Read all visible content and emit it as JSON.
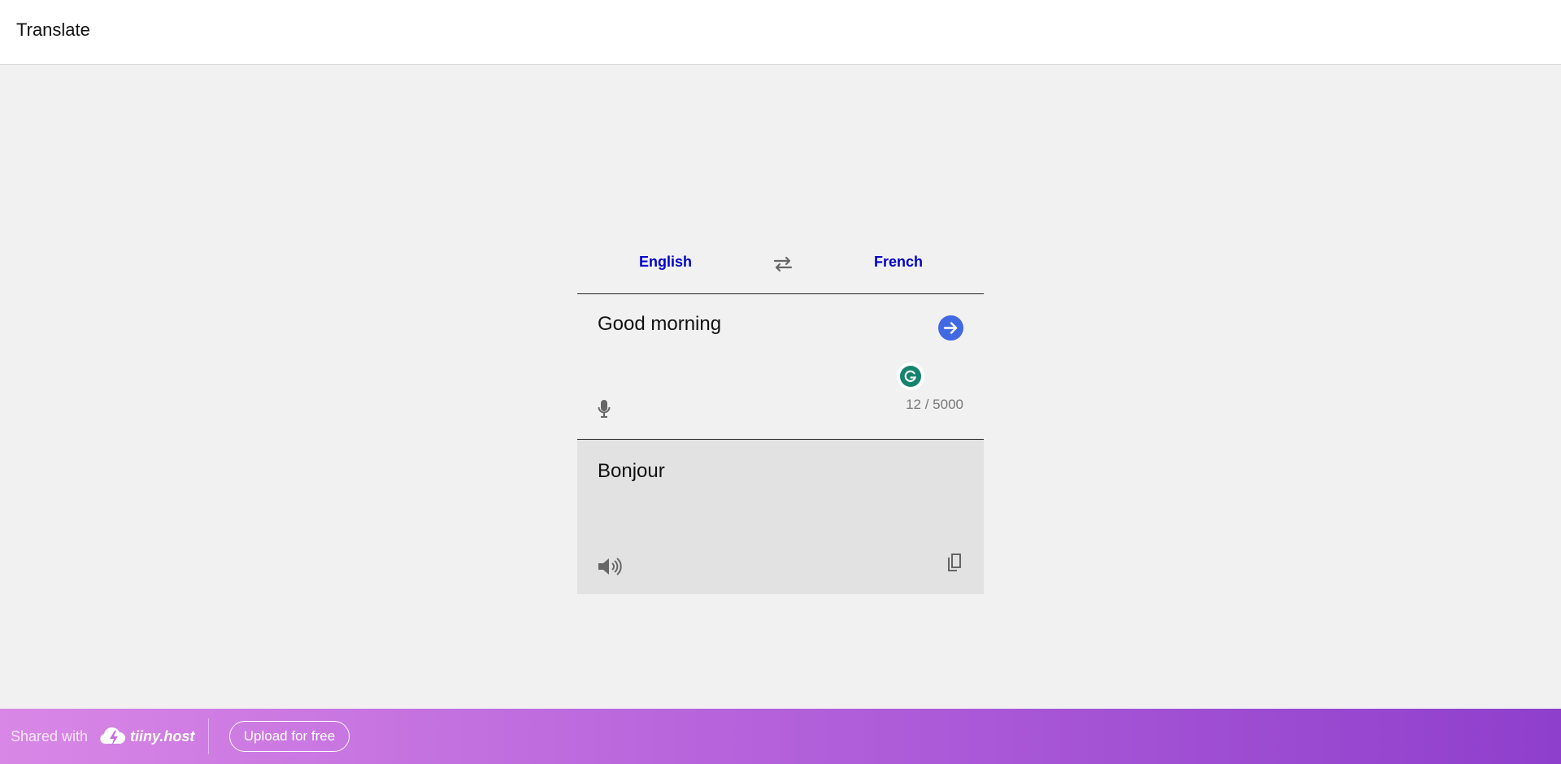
{
  "header": {
    "title": "Translate"
  },
  "languages": {
    "source": "English",
    "target": "French"
  },
  "input": {
    "text": "Good morning",
    "counter": "12 / 5000"
  },
  "output": {
    "text": "Bonjour"
  },
  "footer": {
    "shared_label": "Shared with",
    "brand": "tiiny.host",
    "upload_label": "Upload for free"
  },
  "colors": {
    "link_blue": "#0000cc",
    "go_button": "#4169e1",
    "grammarly_green": "#15846e",
    "footer_gradient_start": "#d987e6",
    "footer_gradient_end": "#8e3fcc"
  },
  "icons": {
    "swap": "swap-arrows-icon",
    "go": "arrow-right-icon",
    "grammarly": "grammarly-icon",
    "mic": "microphone-icon",
    "speaker": "speaker-icon",
    "copy": "copy-icon",
    "brand": "cloud-bolt-icon"
  }
}
